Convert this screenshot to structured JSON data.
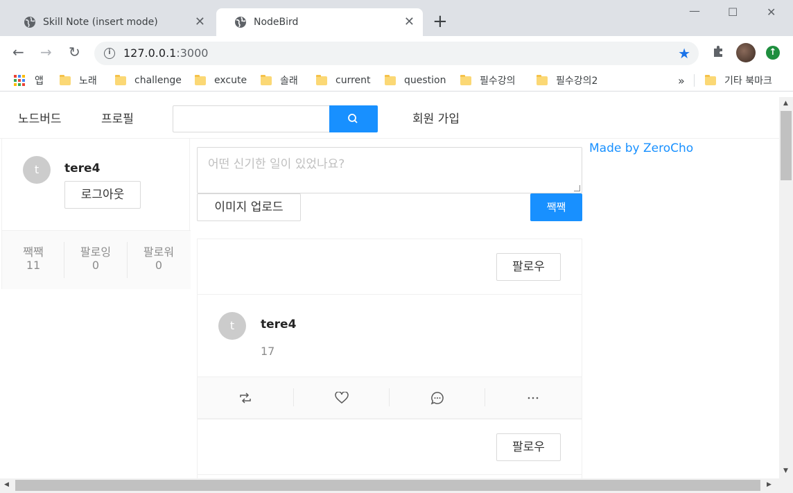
{
  "browser": {
    "tabs": [
      {
        "title": "Skill Note (insert mode)",
        "active": false
      },
      {
        "title": "NodeBird",
        "active": true
      }
    ],
    "address": {
      "host": "127.0.0.1",
      "port": ":3000"
    },
    "bookmarks": [
      "앱",
      "노래",
      "challenge",
      "excute",
      "솔래",
      "current",
      "question",
      "필수강의",
      "필수강의2"
    ],
    "bookmarks_overflow": "»",
    "other_bookmarks": "기타 북마크"
  },
  "nav": {
    "brand": "노드버드",
    "profile": "프로필",
    "signup": "회원 가입"
  },
  "user": {
    "avatar_initial": "t",
    "nickname": "tere4",
    "logout": "로그아웃",
    "stats": [
      {
        "label": "짹짹",
        "value": "11"
      },
      {
        "label": "팔로잉",
        "value": "0"
      },
      {
        "label": "팔로워",
        "value": "0"
      }
    ]
  },
  "post_form": {
    "placeholder": "어떤 신기한 일이 있었나요?",
    "upload_label": "이미지 업로드",
    "submit_label": "짹짹"
  },
  "posts": [
    {
      "follow_label": "팔로우",
      "avatar_initial": "t",
      "nickname": "tere4",
      "content": "17"
    },
    {
      "follow_label": "팔로우"
    }
  ],
  "footer": {
    "made_by": "Made by ZeroCho"
  },
  "colors": {
    "primary": "#1890ff",
    "tabstrip": "#dee1e6"
  }
}
